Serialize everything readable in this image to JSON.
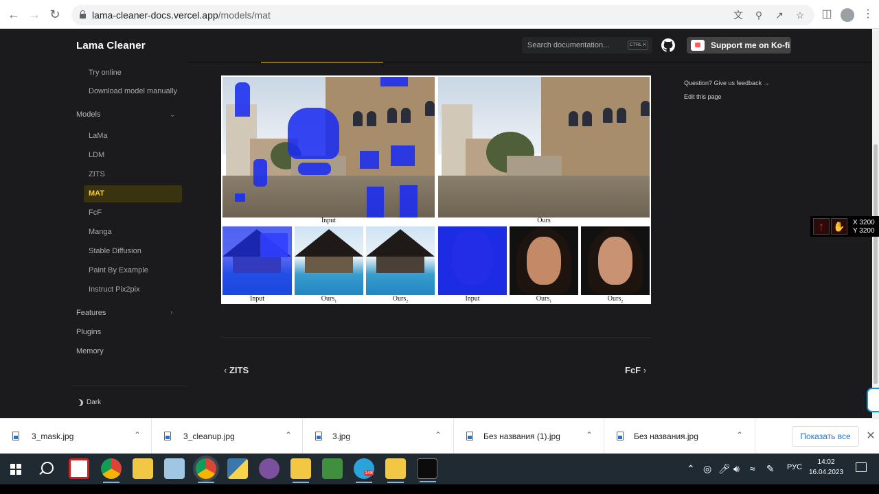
{
  "browser": {
    "url_domain": "lama-cleaner-docs.vercel.app",
    "url_path": "/models/mat"
  },
  "navbar": {
    "brand": "Lama Cleaner",
    "search_placeholder": "Search documentation...",
    "search_shortcut": "CTRL K",
    "support_label": "Support me on Ko-fi"
  },
  "sidebar": {
    "top_items": [
      {
        "label": "Try online"
      },
      {
        "label": "Download model manually"
      }
    ],
    "models_label": "Models",
    "model_items": [
      {
        "label": "LaMa"
      },
      {
        "label": "LDM"
      },
      {
        "label": "ZITS"
      },
      {
        "label": "MAT",
        "active": true
      },
      {
        "label": "FcF"
      },
      {
        "label": "Manga"
      },
      {
        "label": "Stable Diffusion"
      },
      {
        "label": "Paint By Example"
      },
      {
        "label": "Instruct Pix2pix"
      }
    ],
    "features_label": "Features",
    "plugins_label": "Plugins",
    "memory_label": "Memory",
    "theme_label": "Dark"
  },
  "figure": {
    "captions": {
      "input_top": "Input",
      "ours_top": "Ours",
      "input_house": "Input",
      "ours1_house": "Ours",
      "ours2_house": "Ours",
      "input_face": "Input",
      "ours1_face": "Ours",
      "ours2_face": "Ours",
      "sub1": "1",
      "sub2": "2"
    }
  },
  "pager": {
    "prev_label": "ZITS",
    "next_label": "FcF"
  },
  "toc": {
    "feedback": "Question? Give us feedback →",
    "edit": "Edit this page"
  },
  "mouse_widget": {
    "x_readout": "X 3200",
    "y_readout": "Y 3200"
  },
  "downloads": {
    "items": [
      {
        "name": "3_mask.jpg"
      },
      {
        "name": "3_cleanup.jpg"
      },
      {
        "name": "3.jpg"
      },
      {
        "name": "Без названия (1).jpg"
      },
      {
        "name": "Без названия.jpg"
      }
    ],
    "show_all_label": "Показать все"
  },
  "taskbar": {
    "telegram_badge": "148",
    "language": "РУС",
    "time": "14:02",
    "date": "16.04.2023"
  },
  "colors": {
    "accent_active": "#3a3310",
    "mask_blue": "#1a2cf0",
    "link_blue": "#1a73e8"
  }
}
